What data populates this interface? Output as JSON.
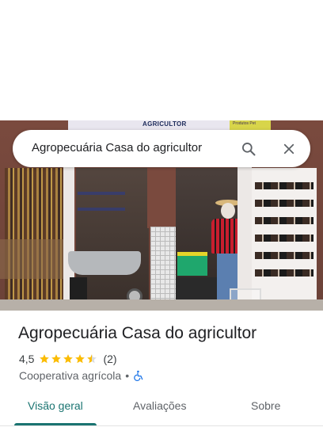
{
  "search": {
    "query": "Agropecuária Casa do agricultor",
    "search_icon": "search-icon",
    "close_icon": "close-icon"
  },
  "photo": {
    "sign_text": "AGRICULTOR",
    "sign_small_text": "Produtos Pet"
  },
  "place": {
    "name": "Agropecuária Casa do agricultor",
    "rating": "4,5",
    "stars": 4.5,
    "review_count": "(2)",
    "category": "Cooperativa agrícola",
    "separator": "•",
    "accessibility_icon": "wheelchair-icon"
  },
  "tabs": [
    {
      "label": "Visão geral",
      "active": true
    },
    {
      "label": "Avaliações",
      "active": false
    },
    {
      "label": "Sobre",
      "active": false
    }
  ],
  "colors": {
    "accent": "#1a7471",
    "star": "#fbbc04",
    "accessibility": "#1a73e8"
  }
}
